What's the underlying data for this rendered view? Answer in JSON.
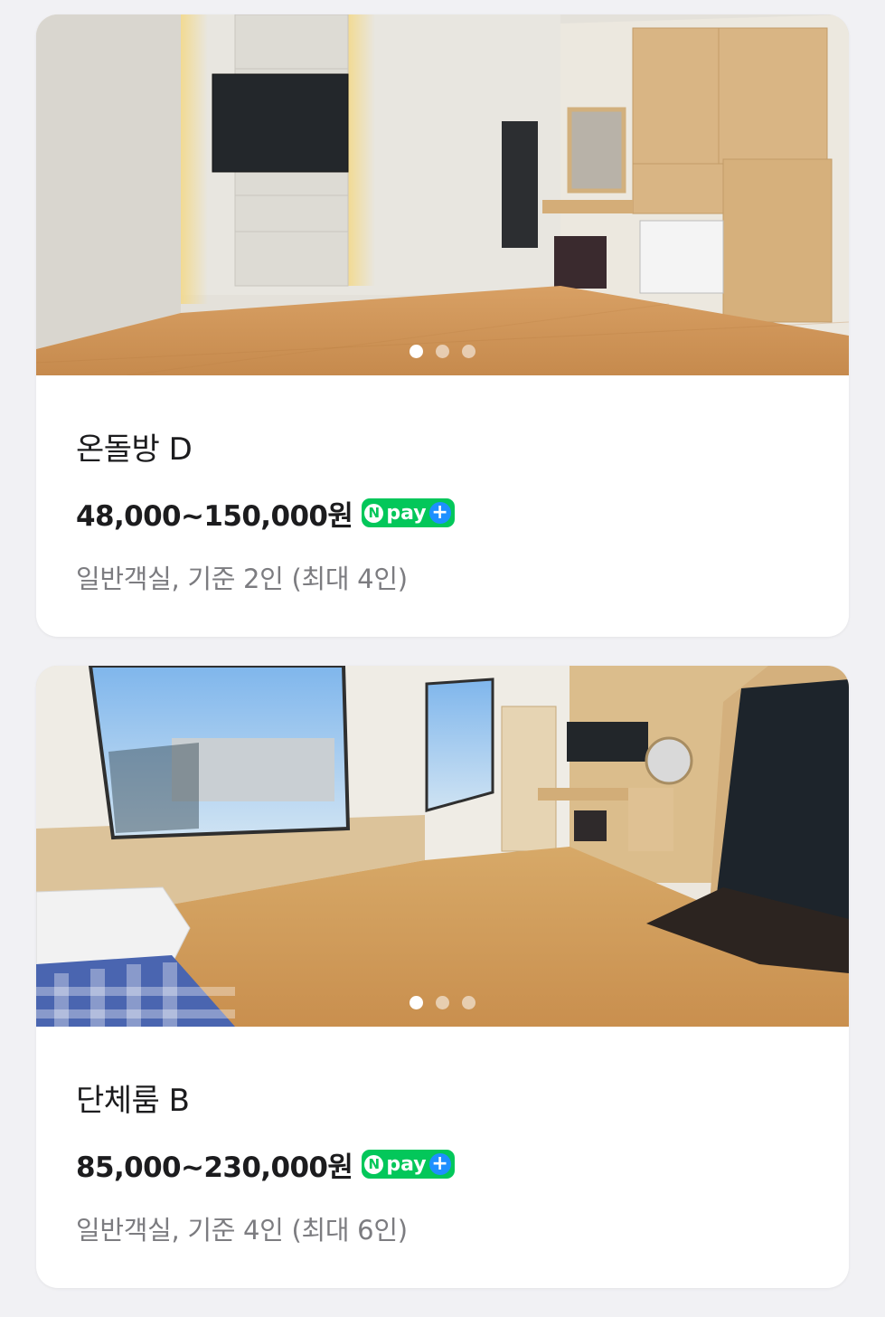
{
  "rooms": [
    {
      "name": "온돌방 D",
      "price": "48,000~150,000원",
      "badge": {
        "n_label": "N",
        "pay_label": "pay",
        "plus_label": "+"
      },
      "description": "일반객실, 기준 2인 (최대 4인)",
      "carousel": {
        "count": 3,
        "active": 1
      }
    },
    {
      "name": "단체룸 B",
      "price": "85,000~230,000원",
      "badge": {
        "n_label": "N",
        "pay_label": "pay",
        "plus_label": "+"
      },
      "description": "일반객실, 기준 4인 (최대 6인)",
      "carousel": {
        "count": 3,
        "active": 1
      }
    }
  ],
  "colors": {
    "background": "#f1f1f4",
    "card": "#ffffff",
    "npay_green": "#03c75a",
    "npay_plus_blue": "#1e90ff",
    "text_primary": "#1c1c1e",
    "text_secondary": "#7c7c80"
  }
}
